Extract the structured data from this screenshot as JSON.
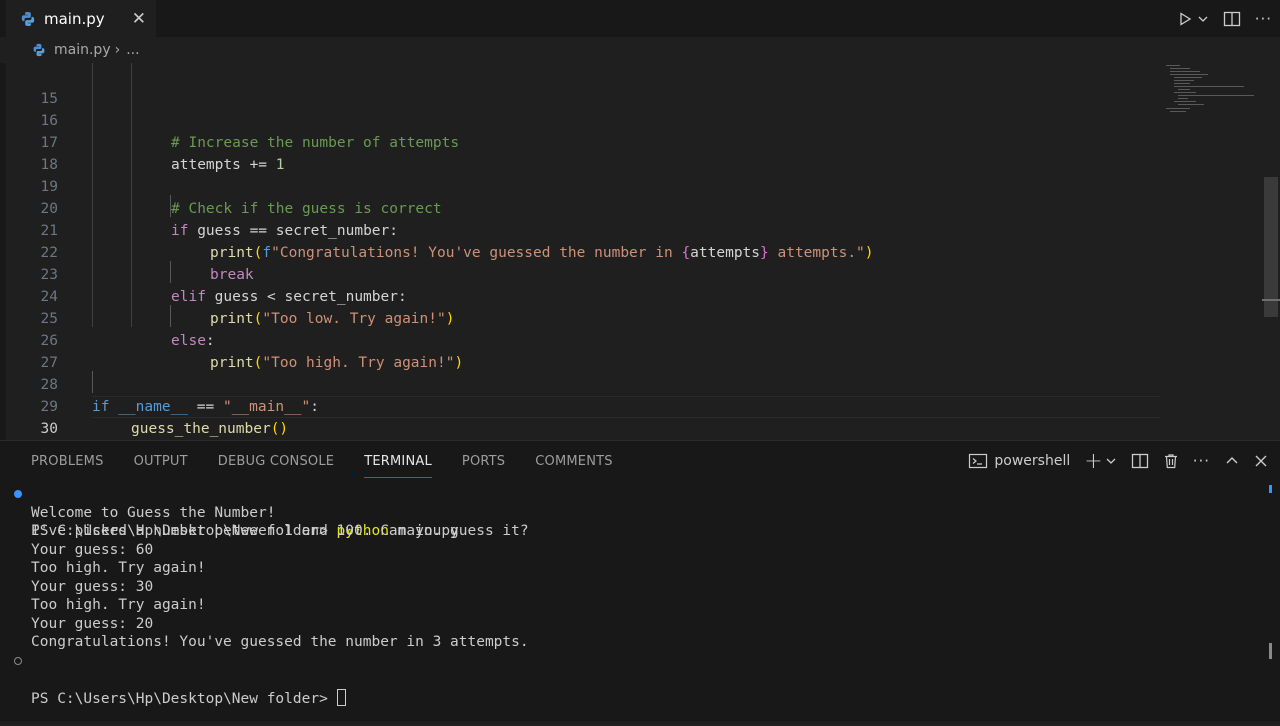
{
  "tabbar": {
    "active_tab": {
      "name": "main.py",
      "close_glyph": "✕",
      "icon": "python-icon"
    },
    "actions": {
      "run": "play-icon",
      "run_menu": "chevron-down-icon",
      "split": "split-editor-icon",
      "more": "···"
    }
  },
  "breadcrumb": {
    "file": "main.py",
    "separator": "›",
    "more": "..."
  },
  "editor": {
    "lines": [
      {
        "n": "15"
      },
      {
        "n": "16"
      },
      {
        "n": "17"
      },
      {
        "n": "18"
      },
      {
        "n": "19"
      },
      {
        "n": "20"
      },
      {
        "n": "21"
      },
      {
        "n": "22"
      },
      {
        "n": "23"
      },
      {
        "n": "24"
      },
      {
        "n": "25"
      },
      {
        "n": "26"
      },
      {
        "n": "27"
      },
      {
        "n": "28"
      },
      {
        "n": "29"
      },
      {
        "n": "30"
      }
    ],
    "code": {
      "l16_comment": "# Increase the number of attempts",
      "l17_var": "attempts",
      "l17_op": " += ",
      "l17_num": "1",
      "l19_comment": "# Check if the guess is correct",
      "l20_kw": "if",
      "l20_rest": " guess == secret_number:",
      "l21_fn": "print",
      "l21_open": "(",
      "l21_f": "f",
      "l21_str1": "\"Congratulations! You've guessed the number in ",
      "l21_lb": "{",
      "l21_var": "attempts",
      "l21_rb": "}",
      "l21_str2": " attempts.\"",
      "l21_close": ")",
      "l22_kw": "break",
      "l23_kw": "elif",
      "l23_rest": " guess < secret_number:",
      "l24_fn": "print",
      "l24_str": "\"Too low. Try again!\"",
      "l25_kw": "else",
      "l25_rest": ":",
      "l26_fn": "print",
      "l26_str": "\"Too high. Try again!\"",
      "l28_kw": "if",
      "l28_var": "__name__",
      "l28_op": " == ",
      "l28_str": "\"__main__\"",
      "l28_colon": ":",
      "l29_fn": "guess_the_number",
      "l29_parens": "()"
    }
  },
  "panel": {
    "tabs": [
      "PROBLEMS",
      "OUTPUT",
      "DEBUG CONSOLE",
      "TERMINAL",
      "PORTS",
      "COMMENTS"
    ],
    "active_tab": "TERMINAL",
    "shell_name": "powershell",
    "actions": {
      "new": "+",
      "more": "···"
    },
    "terminal": {
      "prompt": "PS C:\\Users\\Hp\\Desktop\\New folder> ",
      "command_word": "python",
      "command_arg": " main.py",
      "output": [
        "Welcome to Guess the Number!",
        "I've picked a number between 1 and 100. Can you guess it?",
        "Your guess: 60",
        "Too high. Try again!",
        "Your guess: 30",
        "Too high. Try again!",
        "Your guess: 20",
        "Congratulations! You've guessed the number in 3 attempts."
      ]
    }
  },
  "colors": {
    "accent": "#0078d4",
    "keyword": "#c586c0",
    "function": "#dcdcaa",
    "string": "#ce9178",
    "comment": "#6a9955",
    "variable": "#9cdcfe"
  }
}
